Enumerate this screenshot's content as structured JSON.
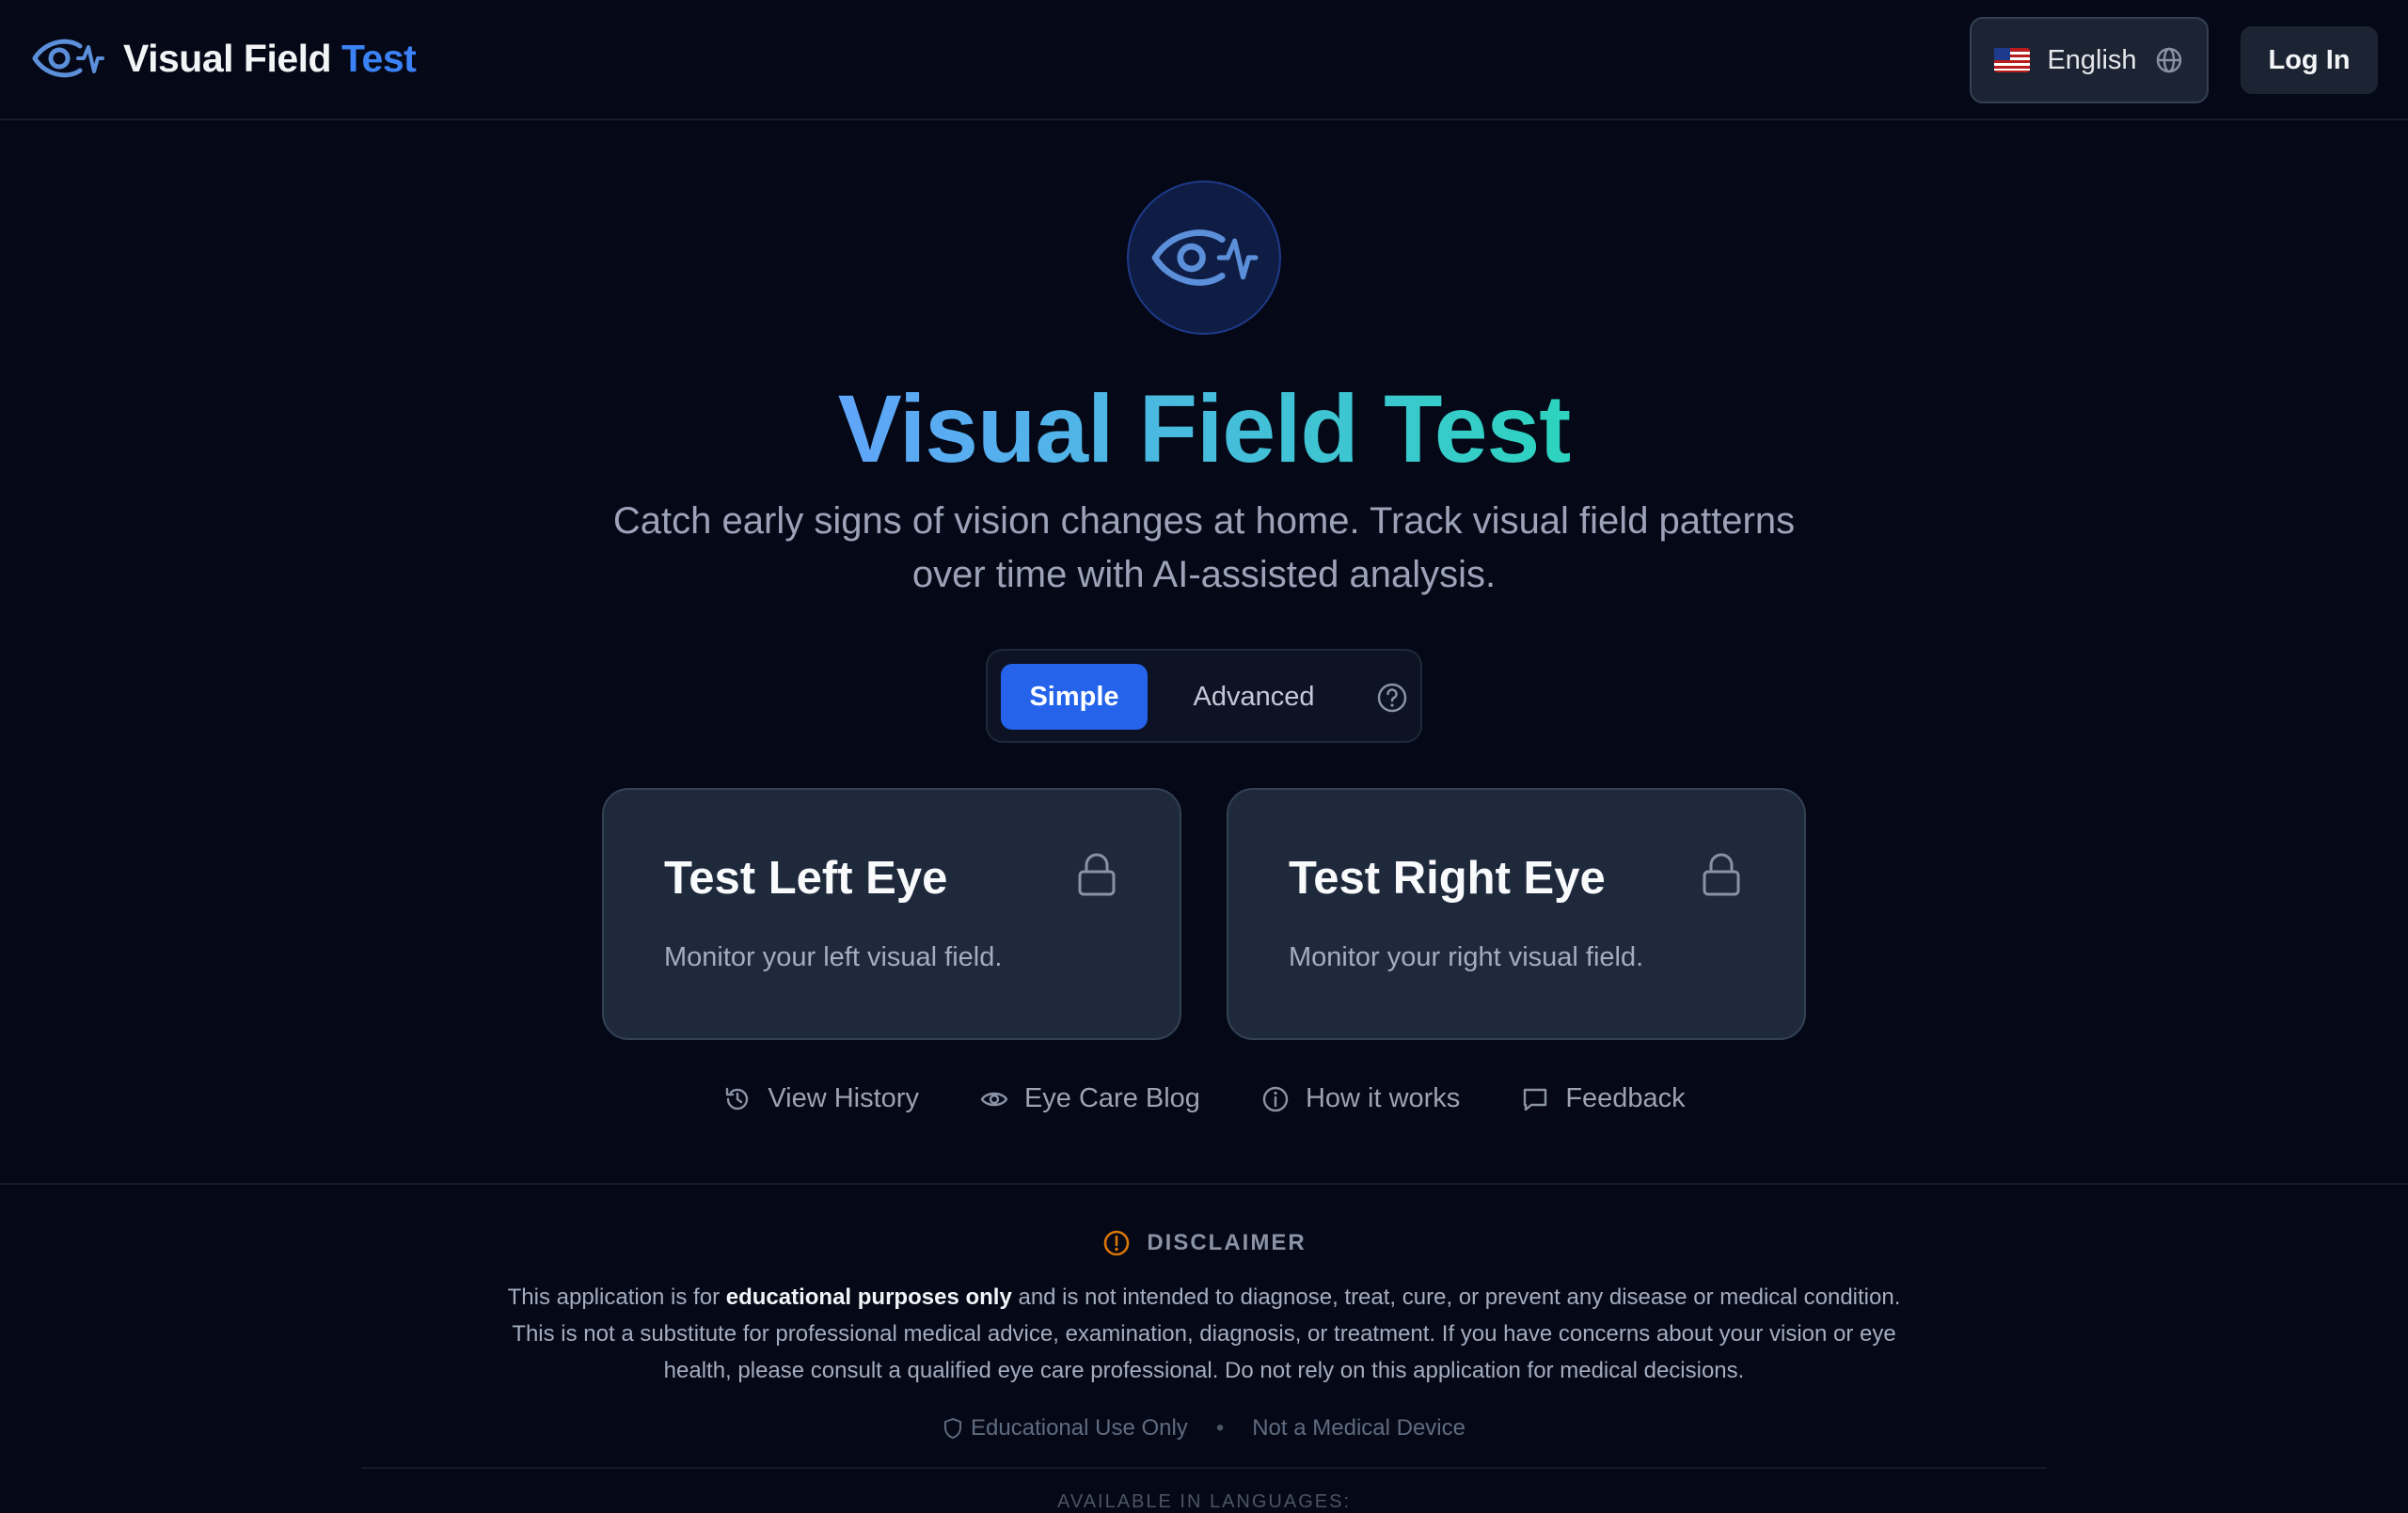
{
  "header": {
    "brand_main": "Visual Field",
    "brand_accent": "Test",
    "language_label": "English",
    "login_label": "Log In"
  },
  "hero": {
    "title": "Visual Field Test",
    "subtitle": "Catch early signs of vision changes at home. Track visual field patterns over time with AI-assisted analysis."
  },
  "mode": {
    "simple_label": "Simple",
    "advanced_label": "Advanced",
    "selected": "Simple"
  },
  "cards": [
    {
      "title": "Test Left Eye",
      "description": "Monitor your left visual field."
    },
    {
      "title": "Test Right Eye",
      "description": "Monitor your right visual field."
    }
  ],
  "links": [
    {
      "label": "View History",
      "icon": "history-icon"
    },
    {
      "label": "Eye Care Blog",
      "icon": "eye-icon"
    },
    {
      "label": "How it works",
      "icon": "info-icon"
    },
    {
      "label": "Feedback",
      "icon": "message-icon"
    }
  ],
  "disclaimer": {
    "heading": "DISCLAIMER",
    "text_before": "This application is for ",
    "text_bold": "educational purposes only",
    "text_after": " and is not intended to diagnose, treat, cure, or prevent any disease or medical condition. This is not a substitute for professional medical advice, examination, diagnosis, or treatment. If you have concerns about your vision or eye health, please consult a qualified eye care professional. Do not rely on this application for medical decisions.",
    "badge_1": "Educational Use Only",
    "separator": "•",
    "badge_2": "Not a Medical Device",
    "available_label": "AVAILABLE IN LANGUAGES:"
  },
  "colors": {
    "background": "#050816",
    "accent": "#2563eb",
    "gradient_start": "#60a5fa",
    "gradient_end": "#2dd4bf",
    "warning": "#d97706"
  }
}
